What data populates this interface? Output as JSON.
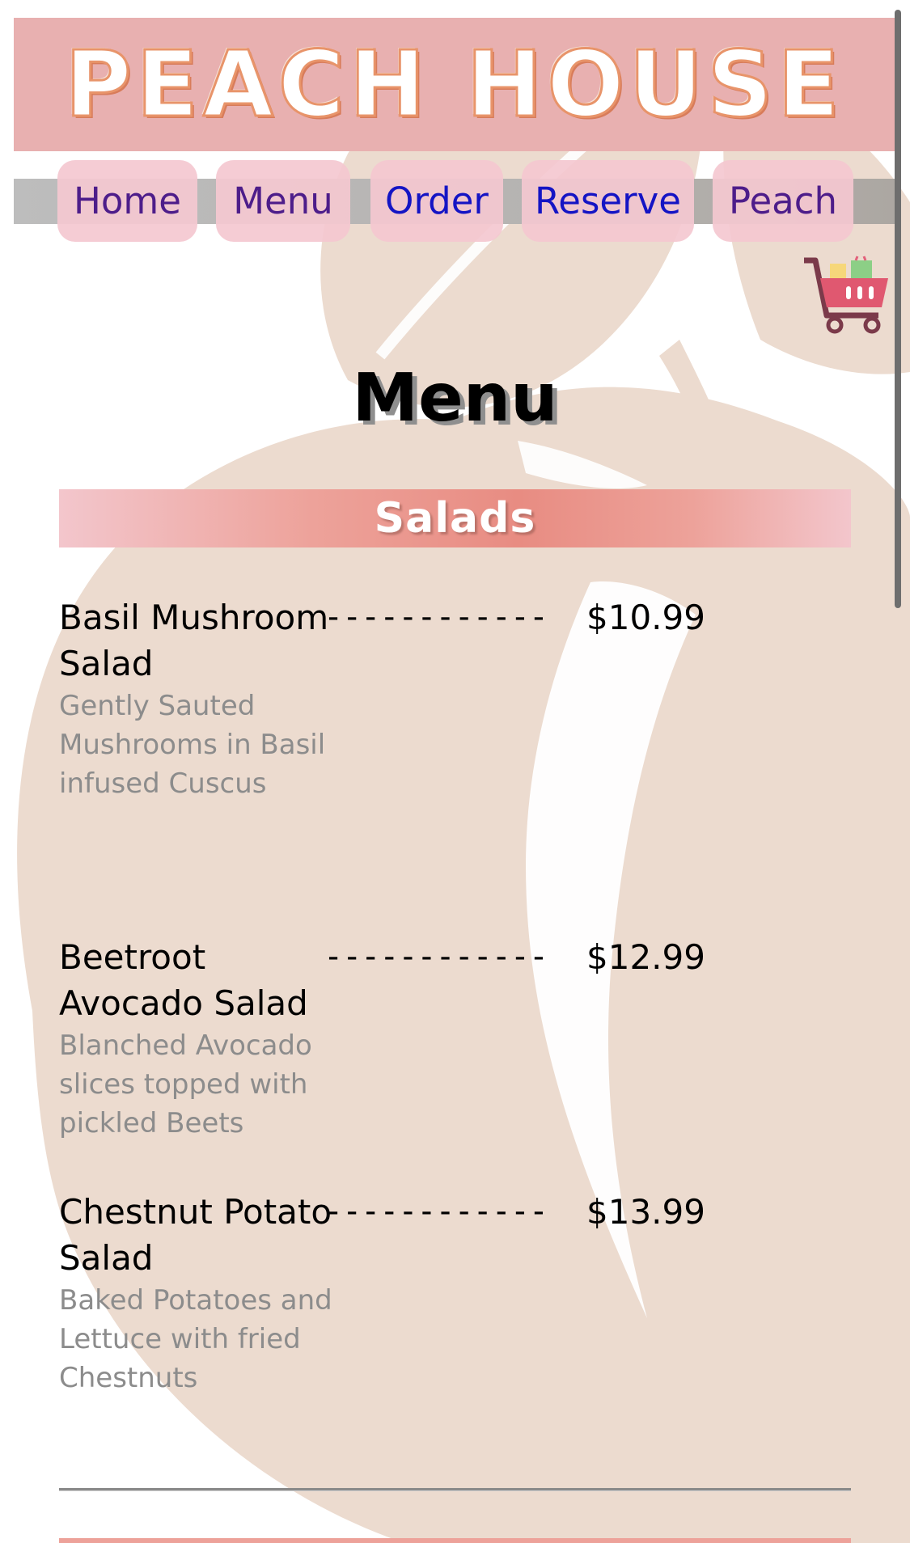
{
  "header": {
    "brand_title": "PEACH HOUSE"
  },
  "nav": {
    "items": [
      {
        "label": "Home"
      },
      {
        "label": "Menu"
      },
      {
        "label": "Order"
      },
      {
        "label": "Reserve"
      },
      {
        "label": "Peach"
      }
    ]
  },
  "cart": {
    "icon": "shopping-cart-icon"
  },
  "page": {
    "title": "Menu"
  },
  "sections": [
    {
      "title": "Salads",
      "items": [
        {
          "name": "Basil Mushroom Salad",
          "separator": "------------",
          "price": "$10.99",
          "description": "Gently Sauted Mushrooms in Basil infused Cuscus"
        },
        {
          "name": "Beetroot Avocado Salad",
          "separator": "------------",
          "price": "$12.99",
          "description": "Blanched Avocado slices topped with pickled Beets"
        },
        {
          "name": "Chestnut Potato Salad",
          "separator": "------------",
          "price": "$13.99",
          "description": "Baked Potatoes and Lettuce with fried Chestnuts"
        }
      ]
    }
  ],
  "colors": {
    "banner_bg": "#e8b0b0",
    "nav_button_bg": "#f4c8d0",
    "nav_text_purple": "#4d1d8a",
    "nav_text_blue": "#1414c4",
    "section_bar": "#e88c82",
    "peach_watermark": "#ecdbcf",
    "description_gray": "#8c8c8c"
  }
}
